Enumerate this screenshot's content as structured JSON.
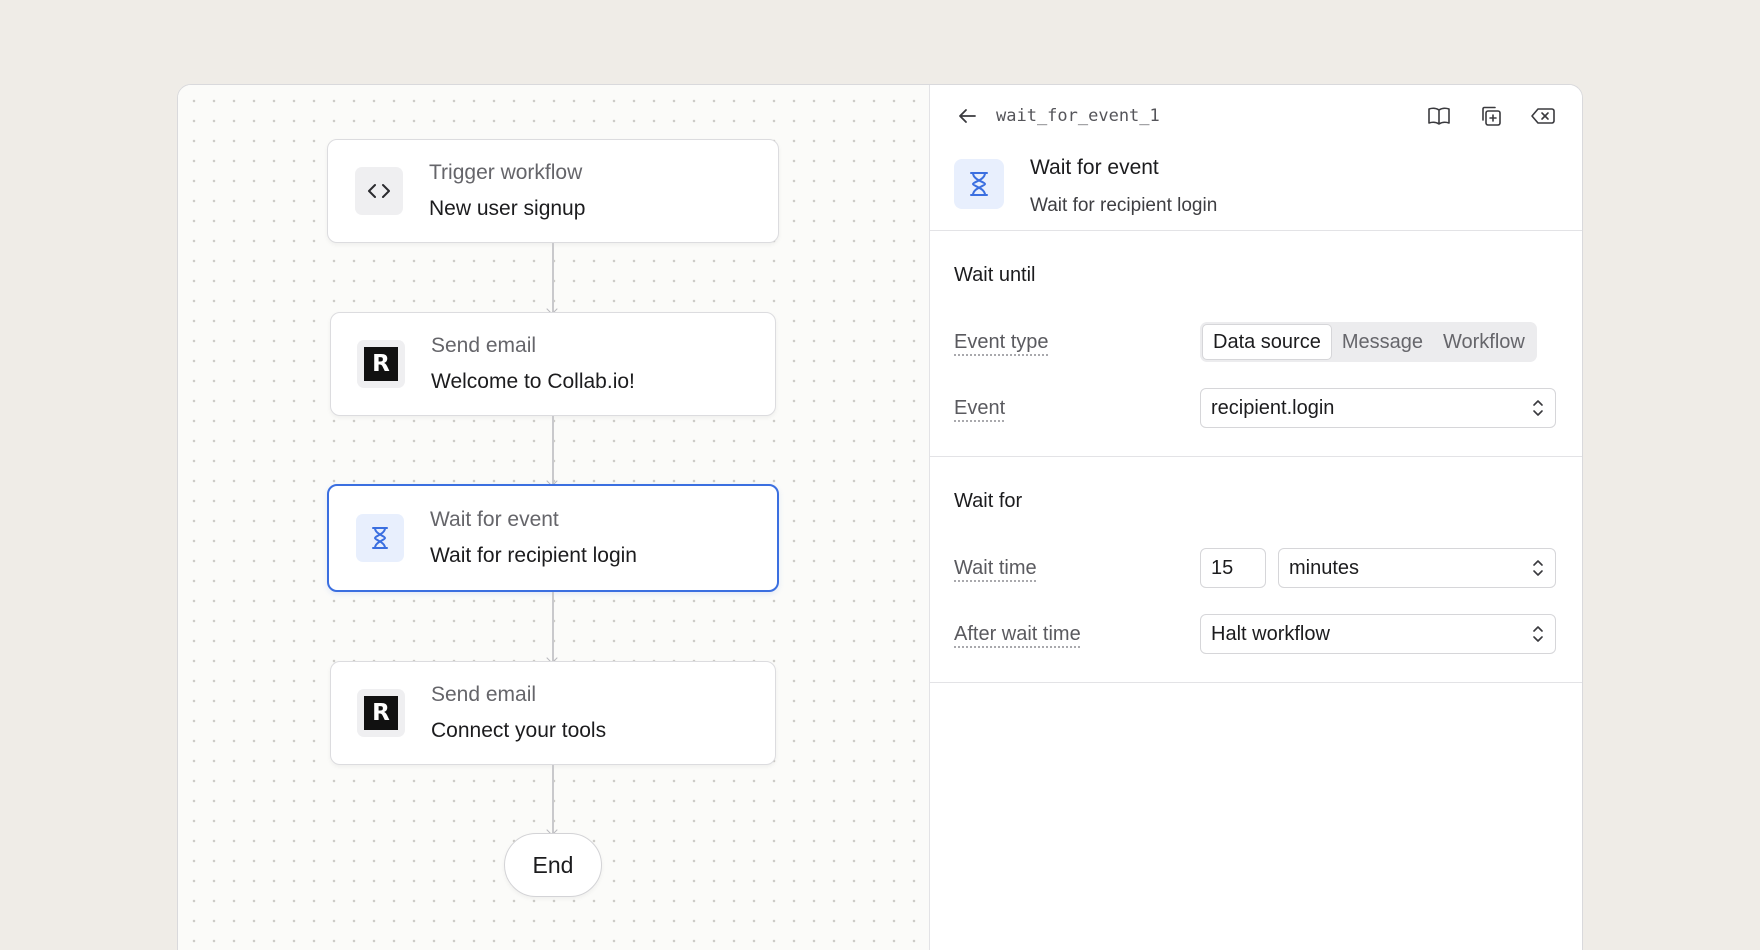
{
  "canvas": {
    "nodes": [
      {
        "title": "Trigger workflow",
        "subtitle": "New user signup",
        "icon": "code-icon"
      },
      {
        "title": "Send email",
        "subtitle": "Welcome to Collab.io!",
        "icon": "resend-logo",
        "logo_letter": "R"
      },
      {
        "title": "Wait for event",
        "subtitle": "Wait for recipient login",
        "icon": "hourglass-icon"
      },
      {
        "title": "Send email",
        "subtitle": "Connect your tools",
        "icon": "resend-logo",
        "logo_letter": "R"
      }
    ],
    "end_label": "End"
  },
  "panel": {
    "node_id": "wait_for_event_1",
    "header_icons": [
      "arrow-left-icon",
      "book-icon",
      "duplicate-icon",
      "delete-icon"
    ],
    "summary": {
      "title": "Wait for event",
      "subtitle": "Wait for recipient login"
    },
    "wait_until": {
      "heading": "Wait until",
      "event_type_label": "Event type",
      "event_type_options": [
        "Data source",
        "Message",
        "Workflow"
      ],
      "event_type_selected": "Data source",
      "event_label": "Event",
      "event_value": "recipient.login"
    },
    "wait_for": {
      "heading": "Wait for",
      "wait_time_label": "Wait time",
      "wait_time_value": "15",
      "wait_time_unit": "minutes",
      "after_label": "After wait time",
      "after_value": "Halt workflow"
    }
  },
  "colors": {
    "accent": "#3b6fe0",
    "background": "#efece7",
    "icon_blue_bg": "#e8effd"
  }
}
